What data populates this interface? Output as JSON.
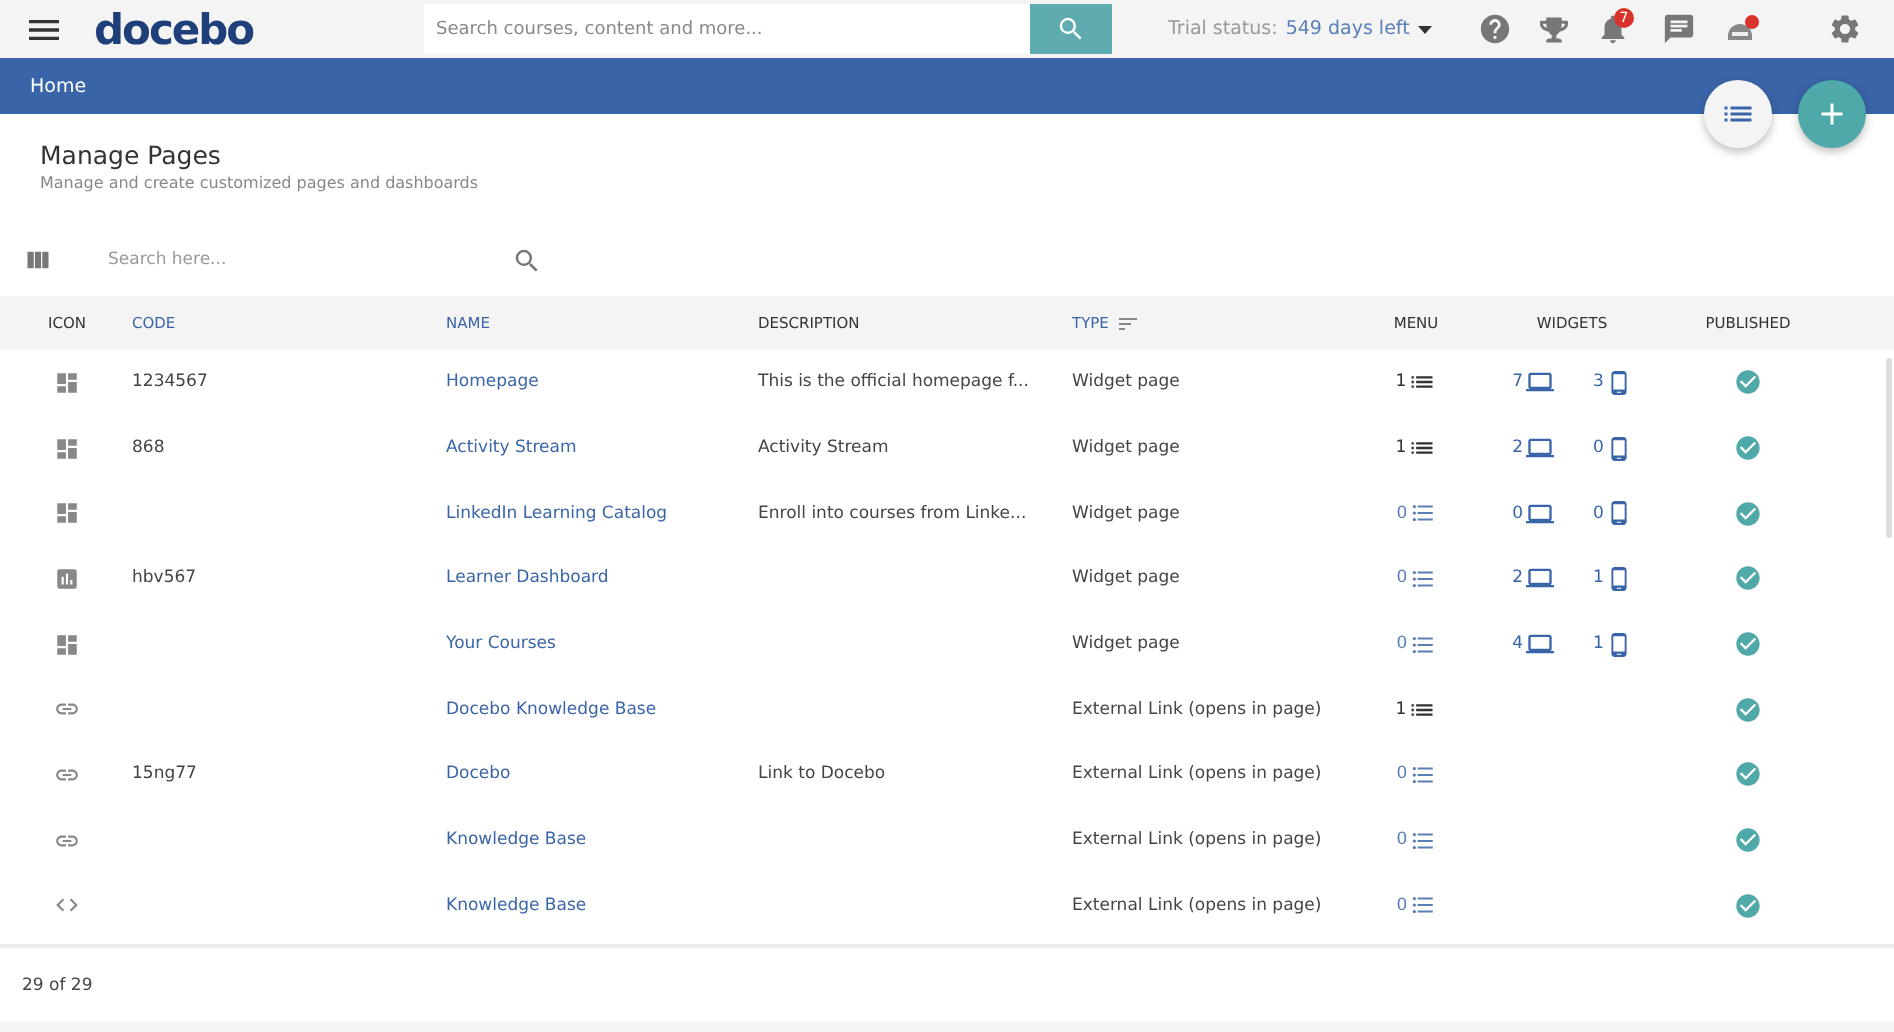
{
  "topbar": {
    "logo": "docebo",
    "search_placeholder": "Search courses, content and more...",
    "trial_label": "Trial status:",
    "trial_value": "549 days left",
    "notification_count": "7"
  },
  "breadcrumb": "Home",
  "page": {
    "title": "Manage Pages",
    "subtitle": "Manage and create customized pages and dashboards"
  },
  "table_search": {
    "placeholder": "Search here..."
  },
  "table": {
    "columns": [
      {
        "label": "ICON",
        "sortable": false
      },
      {
        "label": "CODE",
        "sortable": true
      },
      {
        "label": "NAME",
        "sortable": true
      },
      {
        "label": "DESCRIPTION",
        "sortable": false
      },
      {
        "label": "TYPE",
        "sortable": true
      },
      {
        "label": "MENU",
        "sortable": false
      },
      {
        "label": "WIDGETS",
        "sortable": false
      },
      {
        "label": "PUBLISHED",
        "sortable": false
      }
    ],
    "rows": [
      {
        "kind": "widget",
        "code": "1234567",
        "name": "Homepage",
        "description": "This is the official homepage f...",
        "type": "Widget page",
        "menu": "1",
        "menu_assigned": true,
        "desktop_widgets": "7",
        "mobile_widgets": "3",
        "published": true
      },
      {
        "kind": "widget",
        "code": "868",
        "name": "Activity Stream",
        "description": "Activity Stream",
        "type": "Widget page",
        "menu": "1",
        "menu_assigned": true,
        "desktop_widgets": "2",
        "mobile_widgets": "0",
        "published": true
      },
      {
        "kind": "widget",
        "name": "LinkedIn Learning Catalog",
        "description": "Enroll into courses from Linke...",
        "type": "Widget page",
        "menu": "0",
        "menu_assigned": false,
        "desktop_widgets": "0",
        "mobile_widgets": "0",
        "published": true
      },
      {
        "kind": "dashboard",
        "code": "hbv567",
        "name": "Learner Dashboard",
        "type": "Widget page",
        "menu": "0",
        "menu_assigned": false,
        "desktop_widgets": "2",
        "mobile_widgets": "1",
        "published": true
      },
      {
        "kind": "widget",
        "name": "Your Courses",
        "type": "Widget page",
        "menu": "0",
        "menu_assigned": false,
        "desktop_widgets": "4",
        "mobile_widgets": "1",
        "published": true
      },
      {
        "kind": "link",
        "name": "Docebo Knowledge Base",
        "type": "External Link (opens in page)",
        "menu": "1",
        "menu_assigned": true,
        "published": true
      },
      {
        "kind": "link",
        "code": "15ng77",
        "name": "Docebo",
        "description": "Link to Docebo",
        "type": "External Link (opens in page)",
        "menu": "0",
        "menu_assigned": false,
        "published": true
      },
      {
        "kind": "link",
        "name": "Knowledge Base",
        "type": "External Link (opens in page)",
        "menu": "0",
        "menu_assigned": false,
        "published": true
      },
      {
        "kind": "embed",
        "name": "Knowledge Base",
        "type": "External Link (opens in page)",
        "menu": "0",
        "menu_assigned": false,
        "published": true
      }
    ]
  },
  "footer": {
    "count": "29 of 29"
  }
}
